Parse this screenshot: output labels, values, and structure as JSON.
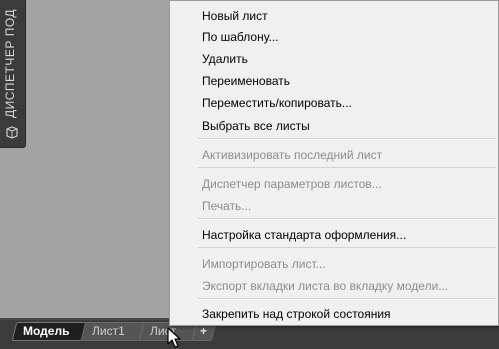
{
  "palette": {
    "label": "ДИСПЕТЧЕР ПОД",
    "icon": "palette-icon"
  },
  "layout_tabs": {
    "model_label": "Модель",
    "sheet1_label": "Лист1",
    "sheet2_label": "Лист",
    "add_label": "+"
  },
  "menu": {
    "new_sheet": "Новый лист",
    "from_template": "По шаблону...",
    "delete": "Удалить",
    "rename": "Переименовать",
    "move_copy": "Переместить/копировать...",
    "select_all": "Выбрать все листы",
    "activate_last": "Активизировать последний лист",
    "page_setup_manager": "Диспетчер параметров листов...",
    "print": "Печать...",
    "drafting_standard": "Настройка стандарта оформления...",
    "import_sheet": "Импортировать лист...",
    "export_layout": "Экспорт вкладки листа во вкладку модели...",
    "dock_above_status": "Закрепить над строкой состояния"
  },
  "colors": {
    "canvas": "#a3a3a3",
    "menu_bg": "#f0f0f0",
    "disabled_text": "#8d8d8d",
    "tab_strip": "#3c3c3c"
  }
}
